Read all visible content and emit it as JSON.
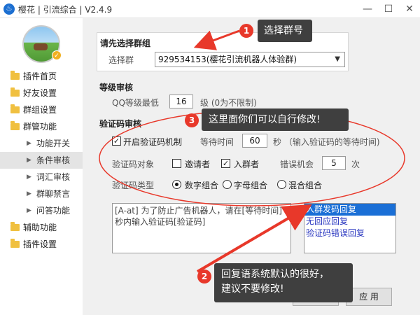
{
  "window": {
    "title": "樱花 | 引流综合 | V2.4.9"
  },
  "sidebar": {
    "items": [
      {
        "label": "插件首页"
      },
      {
        "label": "好友设置"
      },
      {
        "label": "群组设置"
      },
      {
        "label": "群管功能"
      },
      {
        "label": "功能开关"
      },
      {
        "label": "条件审核"
      },
      {
        "label": "词汇审核"
      },
      {
        "label": "群聊禁言"
      },
      {
        "label": "问答功能"
      },
      {
        "label": "辅助功能"
      },
      {
        "label": "插件设置"
      }
    ]
  },
  "group_section": {
    "title": "请先选择群组",
    "select_label": "选择群",
    "selected_group": "929534153(樱花引流机器人体验群)"
  },
  "level_section": {
    "title": "等级审核",
    "qq_level_label": "QQ等级最低",
    "qq_level_value": "16",
    "level_suffix": "级 (0为不限制)"
  },
  "captcha_section": {
    "title": "验证码审核",
    "enable_label": "开启验证码机制",
    "wait_label": "等待时间",
    "wait_value": "60",
    "wait_suffix": "秒 （输入验证码的等待时间)",
    "target_label": "验证码对象",
    "inviter_label": "邀请者",
    "joiner_label": "入群者",
    "error_label": "错误机会",
    "error_value": "5",
    "error_suffix": "次",
    "type_label": "验证码类型",
    "type_options": [
      "数字组合",
      "字母组合",
      "混合组合"
    ]
  },
  "reply": {
    "text": "[A-at] 为了防止广告机器人，请在[等待时间]秒内输入验证码[验证码]",
    "list": [
      "入群发码回复",
      "无回应回复",
      "验证码错误回复"
    ]
  },
  "buttons": {
    "cancel": "取 消",
    "apply": "应 用"
  },
  "annotations": {
    "n1": "1",
    "c1": "选择群号",
    "n3": "3",
    "c3": "这里面你们可以自行修改!",
    "n2": "2",
    "c2_line1": "回复语系统默认的很好，",
    "c2_line2": "建议不要修改!"
  },
  "colors": {
    "accent": "#1a6fd6",
    "annotation_red": "#e8382a",
    "callout_bg": "#3f3f3f"
  }
}
